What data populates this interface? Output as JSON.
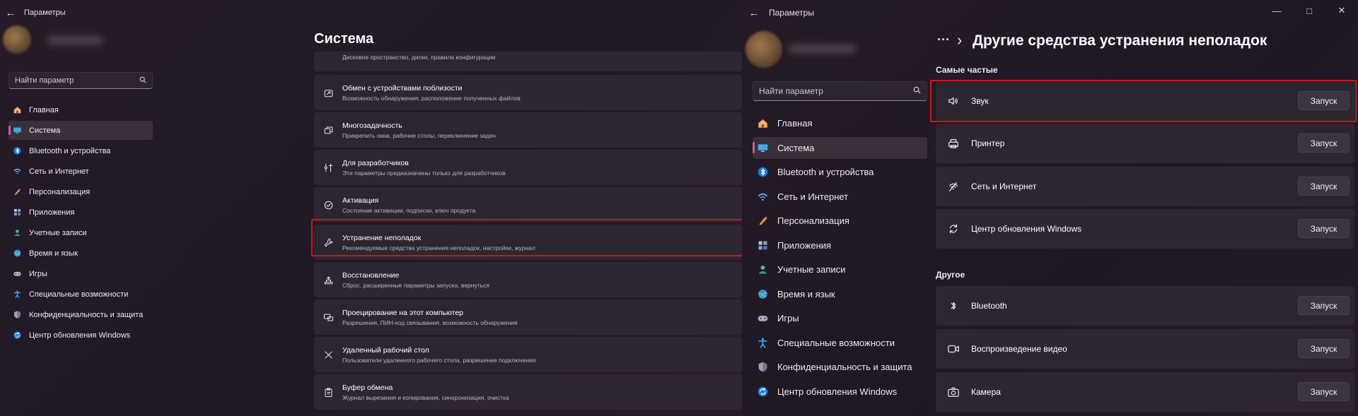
{
  "left_window": {
    "app_title": "Параметры",
    "search_placeholder": "Найти параметр",
    "nav": [
      {
        "label": "Главная",
        "icon": "home-icon"
      },
      {
        "label": "Система",
        "icon": "system-icon",
        "active": true
      },
      {
        "label": "Bluetooth и устройства",
        "icon": "bluetooth-icon"
      },
      {
        "label": "Сеть и Интернет",
        "icon": "wifi-icon"
      },
      {
        "label": "Персонализация",
        "icon": "brush-icon"
      },
      {
        "label": "Приложения",
        "icon": "apps-icon"
      },
      {
        "label": "Учетные записи",
        "icon": "account-icon"
      },
      {
        "label": "Время и язык",
        "icon": "globe-icon"
      },
      {
        "label": "Игры",
        "icon": "gamepad-icon"
      },
      {
        "label": "Специальные возможности",
        "icon": "accessibility-icon"
      },
      {
        "label": "Конфиденциальность и защита",
        "icon": "shield-icon"
      },
      {
        "label": "Центр обновления Windows",
        "icon": "update-icon"
      }
    ],
    "page_title": "Система",
    "items": [
      {
        "title": "",
        "desc": "Дисковое пространство, диски, правила конфигурации",
        "icon": "storage-icon"
      },
      {
        "title": "Обмен с устройствами поблизости",
        "desc": "Возможность обнаружения, расположение полученных файлов",
        "icon": "share-icon"
      },
      {
        "title": "Многозадачность",
        "desc": "Прикрепить окна, рабочие столы, переключение задач",
        "icon": "multitask-icon"
      },
      {
        "title": "Для разработчиков",
        "desc": "Эти параметры предназначены только для разработчиков",
        "icon": "developer-icon"
      },
      {
        "title": "Активация",
        "desc": "Состояние активации, подписки, ключ продукта",
        "icon": "activation-icon"
      },
      {
        "title": "Устранение неполадок",
        "desc": "Рекомендуемые средства устранения неполадок, настройки, журнал",
        "icon": "wrench-icon",
        "highlighted": true
      },
      {
        "title": "Восстановление",
        "desc": "Сброс, расширенные параметры запуска, вернуться",
        "icon": "recovery-icon"
      },
      {
        "title": "Проецирование на этот компьютер",
        "desc": "Разрешения, ПИН-код связывания, возможность обнаружения",
        "icon": "projection-icon"
      },
      {
        "title": "Удаленный рабочий стол",
        "desc": "Пользователи удаленного рабочего стола, разрешение подключения",
        "icon": "remote-desktop-icon"
      },
      {
        "title": "Буфер обмена",
        "desc": "Журнал вырезания и копирования, синхронизация, очистка",
        "icon": "clipboard-icon"
      }
    ]
  },
  "right_window": {
    "app_title": "Параметры",
    "search_placeholder": "Найти параметр",
    "nav": [
      {
        "label": "Главная",
        "icon": "home-icon"
      },
      {
        "label": "Система",
        "icon": "system-icon",
        "active": true
      },
      {
        "label": "Bluetooth и устройства",
        "icon": "bluetooth-icon"
      },
      {
        "label": "Сеть и Интернет",
        "icon": "wifi-icon"
      },
      {
        "label": "Персонализация",
        "icon": "brush-icon"
      },
      {
        "label": "Приложения",
        "icon": "apps-icon"
      },
      {
        "label": "Учетные записи",
        "icon": "account-icon"
      },
      {
        "label": "Время и язык",
        "icon": "globe-icon"
      },
      {
        "label": "Игры",
        "icon": "gamepad-icon"
      },
      {
        "label": "Специальные возможности",
        "icon": "accessibility-icon"
      },
      {
        "label": "Конфиденциальность и защита",
        "icon": "shield-icon"
      },
      {
        "label": "Центр обновления Windows",
        "icon": "update-icon"
      }
    ],
    "breadcrumb_more": "···",
    "breadcrumb_sep": "›",
    "page_title": "Другие средства устранения неполадок",
    "section_frequent": "Самые частые",
    "section_other": "Другое",
    "run_label": "Запуск",
    "frequent": [
      {
        "title": "Звук",
        "icon": "speaker-icon",
        "highlighted": true
      },
      {
        "title": "Принтер",
        "icon": "printer-icon"
      },
      {
        "title": "Сеть и Интернет",
        "icon": "network-icon"
      },
      {
        "title": "Центр обновления Windows",
        "icon": "update-icon"
      }
    ],
    "other": [
      {
        "title": "Bluetooth",
        "icon": "bluetooth-icon"
      },
      {
        "title": "Воспроизведение видео",
        "icon": "video-icon"
      },
      {
        "title": "Камера",
        "icon": "camera-icon"
      }
    ]
  },
  "colors": {
    "background": "#231a25",
    "card": "#2d2630",
    "accent": "#c85aa2",
    "highlight_border": "#d1121b"
  }
}
